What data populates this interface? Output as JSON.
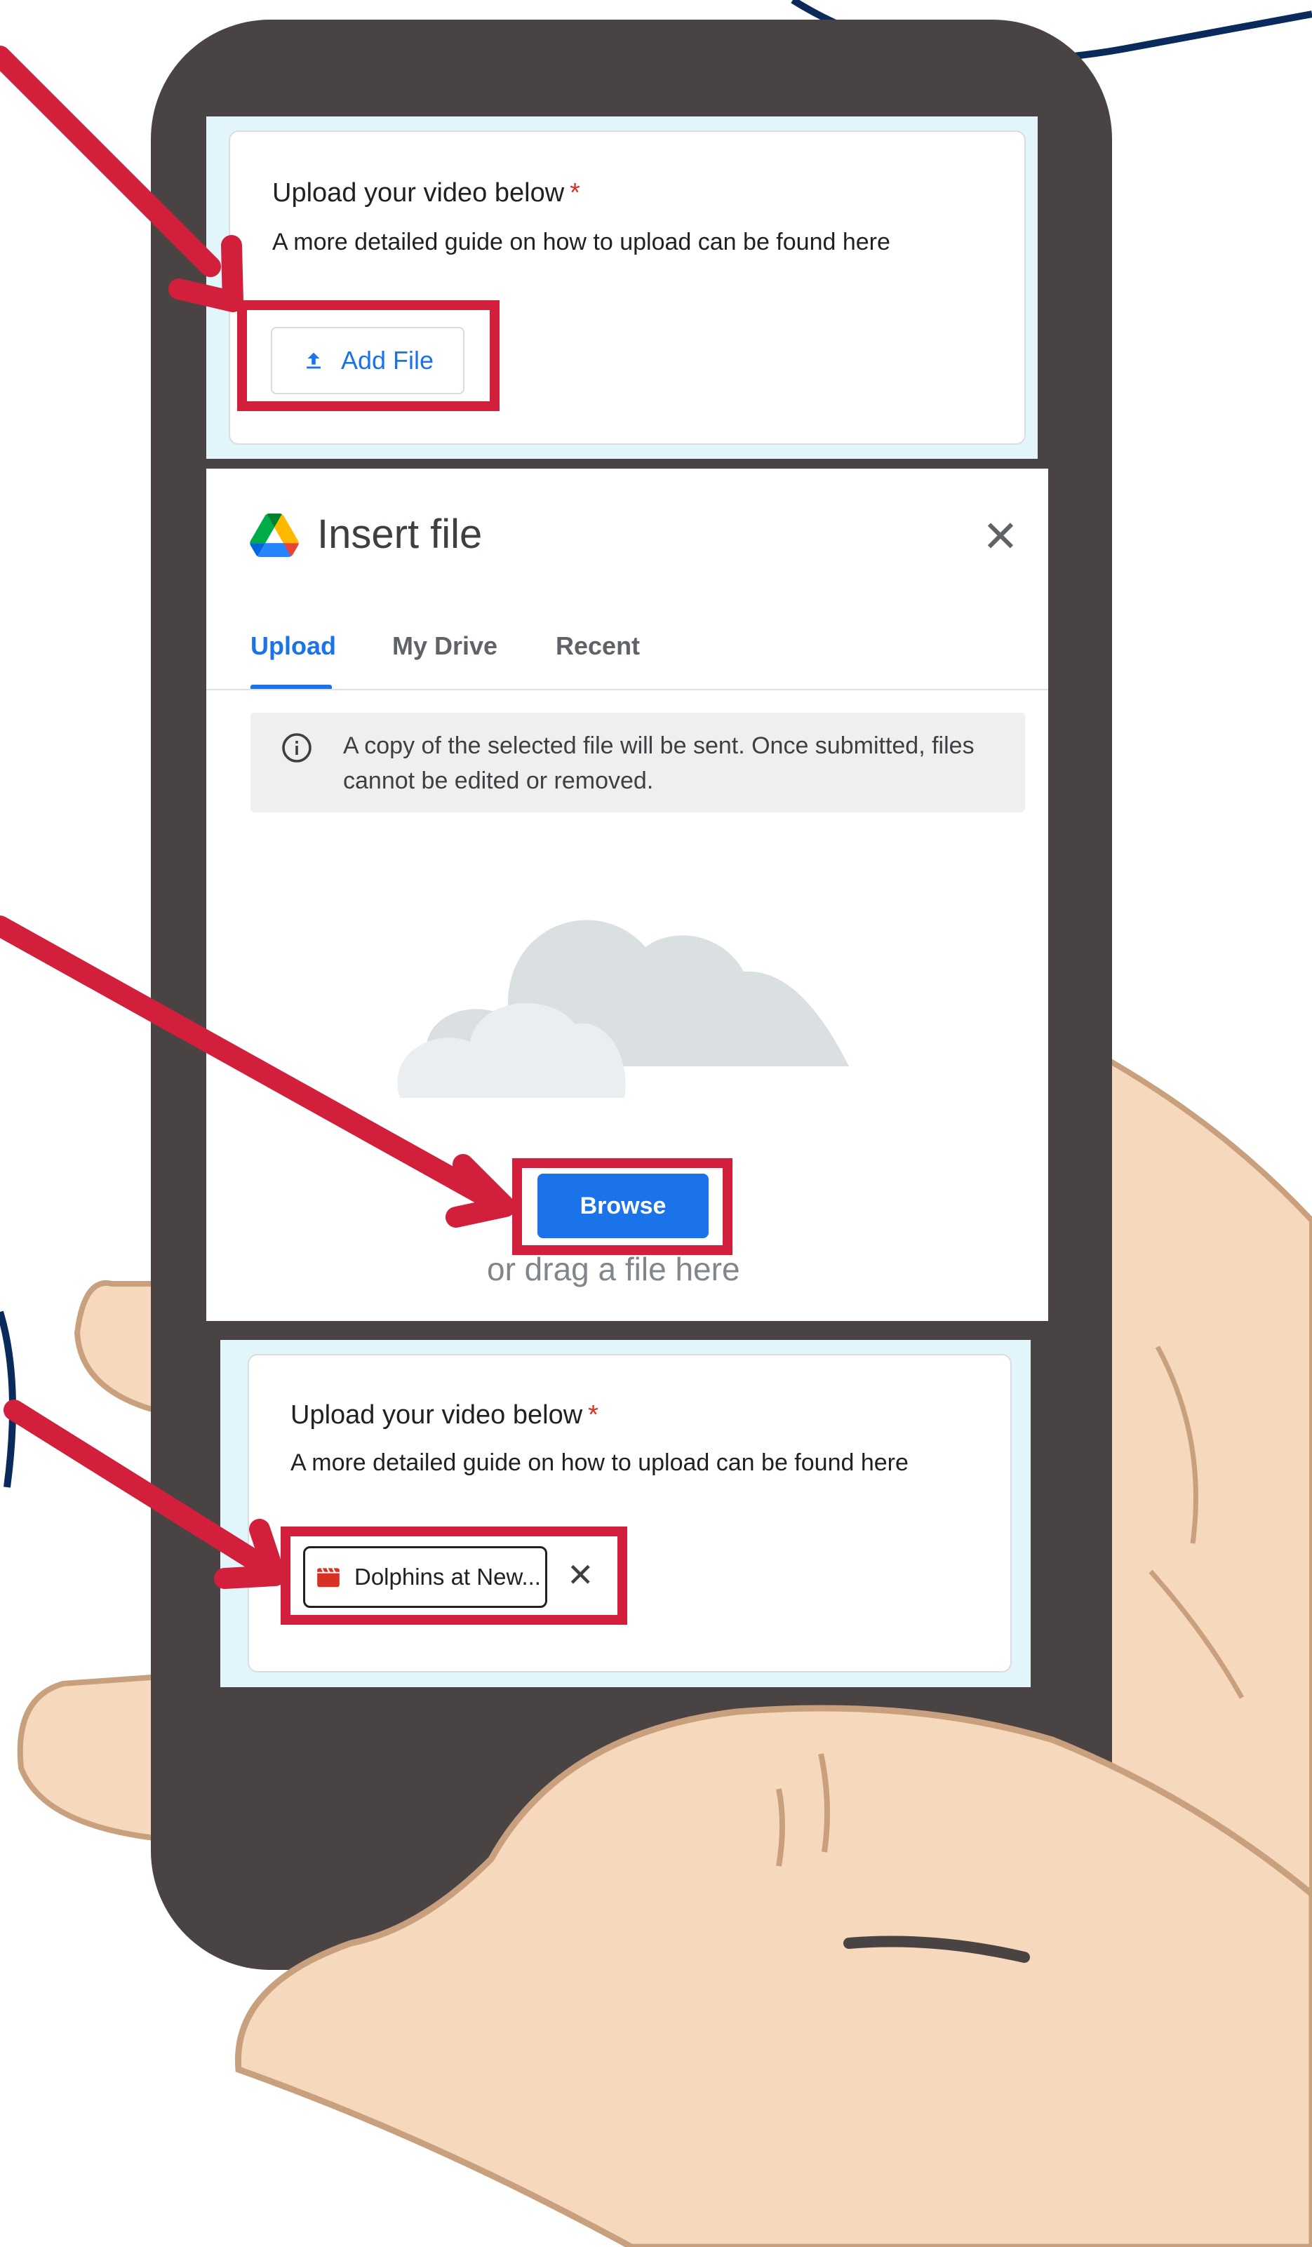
{
  "colors": {
    "accent_blue": "#1a73e8",
    "highlight_red": "#d21f3c",
    "phone_body": "#4a4344",
    "skin": "#f6d8bd",
    "navy_outline": "#0b2a5c"
  },
  "top_form": {
    "question": "Upload your video below",
    "required_mark": "*",
    "description": "A more detailed guide on how to upload can be found here",
    "add_file_label": "Add File",
    "add_file_icon": "upload-icon"
  },
  "dialog": {
    "logo_icon": "google-drive-icon",
    "title": "Insert file",
    "close_icon": "close-icon",
    "tabs": [
      {
        "label": "Upload",
        "active": true
      },
      {
        "label": "My Drive",
        "active": false
      },
      {
        "label": "Recent",
        "active": false
      }
    ],
    "notice_icon": "info-icon",
    "notice_text": "A copy of the selected file will be sent. Once submitted, files cannot be edited or removed.",
    "illustration_icon": "cloud-icon",
    "browse_label": "Browse",
    "drag_text": "or drag a file here"
  },
  "bottom_form": {
    "question": "Upload your video below",
    "required_mark": "*",
    "description": "A more detailed guide on how to upload can be found here",
    "file_icon": "video-file-icon",
    "file_name": "Dolphins at New...",
    "remove_icon": "close-icon"
  }
}
